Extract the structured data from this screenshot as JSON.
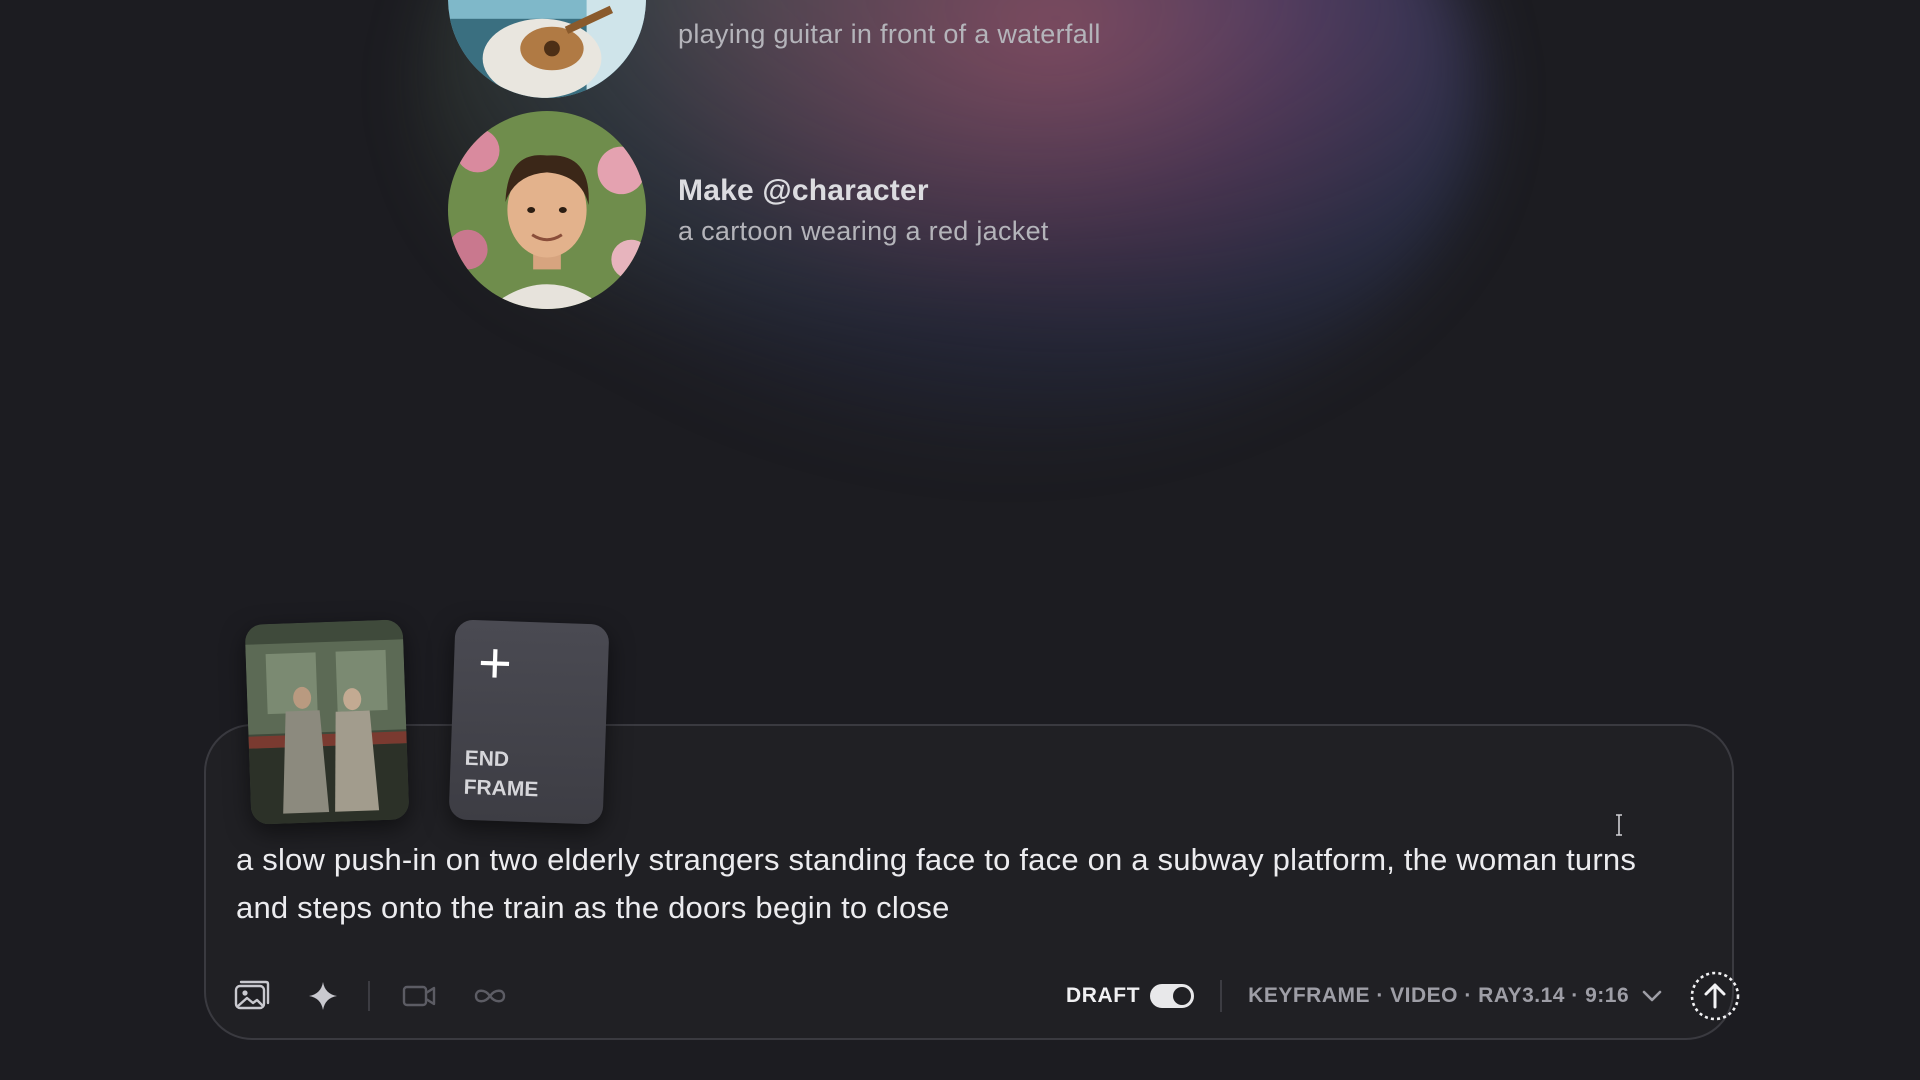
{
  "suggestions": [
    {
      "title": "",
      "subtitle": "playing guitar in front of a waterfall"
    },
    {
      "title": "Make @character",
      "subtitle": "a cartoon wearing a red jacket"
    }
  ],
  "composer": {
    "end_frame_label": "END FRAME",
    "prompt": "a slow push-in on two elderly strangers standing face to face on a subway platform, the woman turns and steps onto the train as the doors begin to close",
    "draft_label": "DRAFT",
    "draft_enabled": true,
    "settings_summary": "KEYFRAME · VIDEO · RAY3.14 · 9:16"
  },
  "icons": {
    "toolbar": [
      "image-reference-icon",
      "sparkle-icon",
      "video-camera-icon",
      "loop-icon"
    ],
    "submit": "arrow-up-icon",
    "settings": "chevron-down-icon",
    "end_frame": "plus-icon"
  }
}
